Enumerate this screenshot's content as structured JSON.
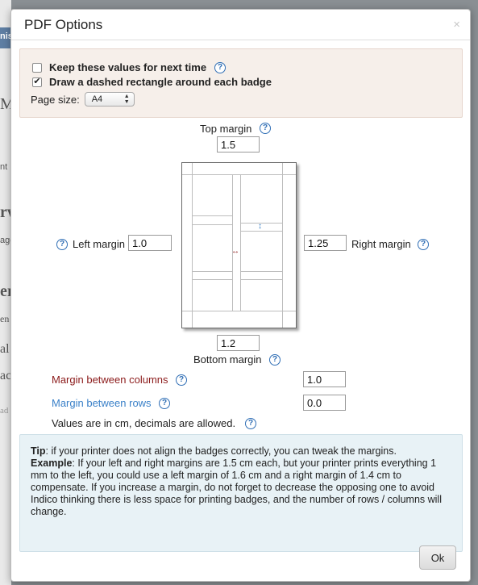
{
  "background": {
    "fragments": [
      "nis",
      "M",
      "nt",
      "rw",
      "age",
      "er",
      "en",
      "al",
      "ac",
      "ad"
    ]
  },
  "dialog": {
    "title": "PDF Options",
    "close_glyph": "×"
  },
  "options": {
    "keep_values": {
      "label": "Keep these values for next time",
      "checked": false
    },
    "dashed_rect": {
      "label": "Draw a dashed rectangle around each badge",
      "checked": true
    },
    "page_size": {
      "label": "Page size:",
      "value": "A4"
    }
  },
  "margins": {
    "top": {
      "label": "Top margin",
      "value": "1.5"
    },
    "left": {
      "label": "Left margin",
      "value": "1.0"
    },
    "right": {
      "label": "Right margin",
      "value": "1.25"
    },
    "bottom": {
      "label": "Bottom margin",
      "value": "1.2"
    }
  },
  "spacing": {
    "columns": {
      "label": "Margin between columns",
      "value": "1.0"
    },
    "rows": {
      "label": "Margin between rows",
      "value": "0.0"
    },
    "units_note": "Values are in cm, decimals are allowed."
  },
  "tip": {
    "tip_label": "Tip",
    "tip_text": ": if your printer does not align the badges correctly, you can tweak the margins.",
    "example_label": "Example",
    "example_text": ": If your left and right margins are 1.5 cm each, but your printer prints everything 1 mm to the left, you could use a left margin of 1.6 cm and a right margin of 1.4 cm to compensate. If you increase a margin, do not forget to decrease the opposing one to avoid Indico thinking there is less space for printing badges, and the number of rows / columns will change."
  },
  "buttons": {
    "ok": "Ok"
  },
  "icons": {
    "help": "?",
    "check": "✔",
    "select_arrows": "▲▼"
  },
  "colors": {
    "help_blue": "#2f6eb5",
    "columns_red": "#8b1a1a",
    "rows_blue": "#3a80c8",
    "options_bg": "#f6efea",
    "tip_bg": "#e8f2f6"
  }
}
